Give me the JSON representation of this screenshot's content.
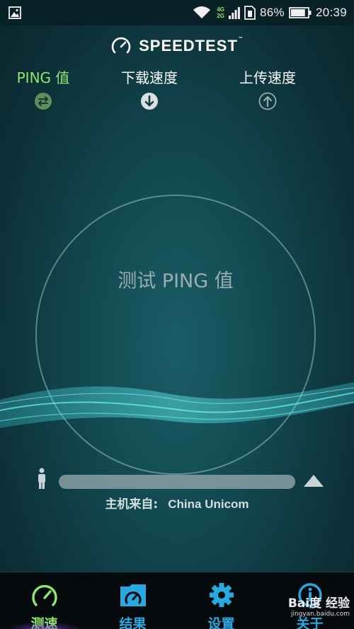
{
  "status_bar": {
    "network_4g": "4G",
    "network_2g": "2G",
    "battery_percent": "86%",
    "battery_level": 0.86,
    "time": "20:39",
    "icons": [
      "gallery-icon",
      "wifi-icon",
      "signal-icon",
      "sim-icon",
      "battery-icon"
    ]
  },
  "header": {
    "title": "SPEEDTEST",
    "trademark": "™",
    "logo_icon": "speedometer-icon"
  },
  "metrics": {
    "ping": {
      "label": "PING 值",
      "icon": "swap-arrows-icon",
      "color": "#8ee86f"
    },
    "download": {
      "label": "下载速度",
      "icon": "arrow-down-circle-icon"
    },
    "upload": {
      "label": "上传速度",
      "icon": "arrow-up-circle-icon"
    }
  },
  "gauge": {
    "status_text": "测试 PING 值"
  },
  "progress": {
    "value": 0,
    "left_icon": "person-icon",
    "right_icon": "server-icon"
  },
  "host": {
    "label": "主机来自:",
    "name": "China Unicom"
  },
  "bottom_nav": {
    "items": [
      {
        "label": "测速",
        "icon": "speedometer-icon",
        "active": true
      },
      {
        "label": "结果",
        "icon": "folder-speedometer-icon",
        "active": false
      },
      {
        "label": "设置",
        "icon": "gear-icon",
        "active": false
      },
      {
        "label": "关于",
        "icon": "info-icon",
        "active": false
      }
    ]
  },
  "watermark": {
    "brand": "Bai度 经验",
    "url": "jingyan.baidu.com"
  },
  "colors": {
    "accent_green": "#8ee86f",
    "nav_blue": "#2aa8e0",
    "background": "#0f3a42"
  }
}
